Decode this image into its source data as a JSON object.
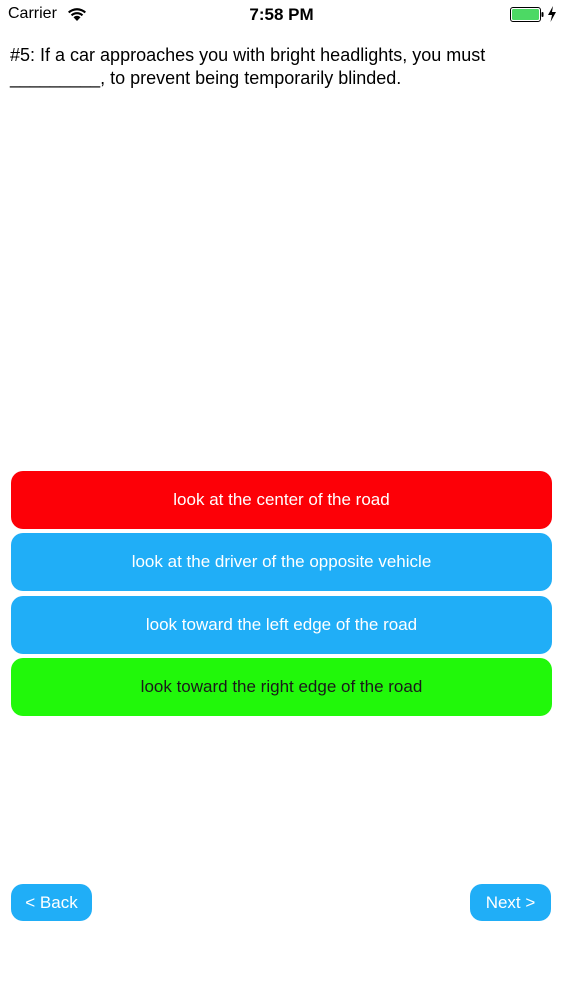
{
  "status_bar": {
    "carrier": "Carrier",
    "time": "7:58 PM",
    "battery_color": "#4cd964"
  },
  "question": {
    "text": "#5: If a car approaches you with bright headlights, you must _________, to prevent being temporarily blinded."
  },
  "answers": [
    {
      "label": "look at the center of the road",
      "color": "#fd0007"
    },
    {
      "label": "look at the driver of the opposite vehicle",
      "color": "#20aef7"
    },
    {
      "label": "look toward the left edge of the road",
      "color": "#20aef7"
    },
    {
      "label": "look toward the right edge of the road",
      "color": "#21f80a"
    }
  ],
  "nav": {
    "back_label": "< Back",
    "next_label": "Next >"
  }
}
